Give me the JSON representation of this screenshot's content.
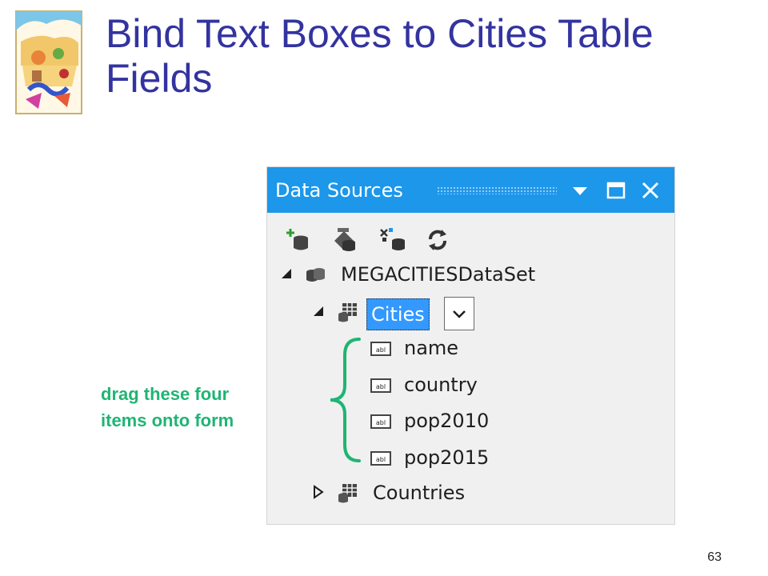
{
  "slide": {
    "title": "Bind Text Boxes to Cities Table Fields",
    "page_number": "63",
    "annotation_line1": "drag  these four",
    "annotation_line2": "items onto form"
  },
  "data_sources_panel": {
    "title": "Data Sources",
    "header_buttons": [
      "dropdown-arrow-icon",
      "maximize-icon",
      "close-icon"
    ],
    "toolbar_icons": [
      "add-new-data-source-icon",
      "edit-dataset-icon",
      "configure-dataset-icon",
      "refresh-icon"
    ],
    "tree": {
      "dataset": "MEGACITIESDataSet",
      "table_selected": "Cities",
      "fields": [
        "name",
        "country",
        "pop2010",
        "pop2015"
      ],
      "table_collapsed": "Countries"
    }
  },
  "colors": {
    "title": "#3333a0",
    "annotation": "#1fb573",
    "header_bg": "#1c97ea",
    "selection": "#3399ff"
  }
}
